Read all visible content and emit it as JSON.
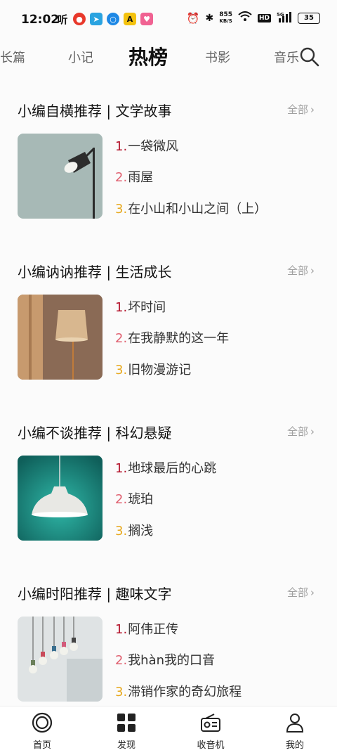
{
  "status_bar": {
    "time": "12:02",
    "speed_value": "855",
    "speed_unit": "KB/S",
    "battery": "35",
    "left_icons": [
      "tingshu-app-icon",
      "weibo-icon",
      "telegram-icon",
      "circle-app-icon",
      "yellow-app-icon",
      "pink-app-icon"
    ],
    "right_icons": [
      "alarm-icon",
      "bluetooth-icon",
      "wifi-icon",
      "hd-icon",
      "signal-5g-icon",
      "battery-icon"
    ]
  },
  "tabs": {
    "items": [
      {
        "label": "长篇",
        "active": false
      },
      {
        "label": "小记",
        "active": false
      },
      {
        "label": "热榜",
        "active": true
      },
      {
        "label": "书影",
        "active": false
      },
      {
        "label": "音乐",
        "active": false
      }
    ],
    "search_icon": "search-icon"
  },
  "sections": [
    {
      "title": "小编自横推荐 | 文学故事",
      "more": "全部",
      "items": [
        {
          "num": "1.",
          "text": "一袋微风"
        },
        {
          "num": "2.",
          "text": "雨屋"
        },
        {
          "num": "3.",
          "text": "在小山和小山之间（上）"
        }
      ]
    },
    {
      "title": "小编讷讷推荐 | 生活成长",
      "more": "全部",
      "items": [
        {
          "num": "1.",
          "text": "坏时间"
        },
        {
          "num": "2.",
          "text": "在我静默的这一年"
        },
        {
          "num": "3.",
          "text": "旧物漫游记"
        }
      ]
    },
    {
      "title": "小编不谈推荐 | 科幻悬疑",
      "more": "全部",
      "items": [
        {
          "num": "1.",
          "text": "地球最后的心跳"
        },
        {
          "num": "2.",
          "text": "琥珀"
        },
        {
          "num": "3.",
          "text": "搁浅"
        }
      ]
    },
    {
      "title": "小编时阳推荐 | 趣味文字",
      "more": "全部",
      "items": [
        {
          "num": "1.",
          "text": "阿伟正传"
        },
        {
          "num": "2.",
          "text": "我hàn我的口音"
        },
        {
          "num": "3.",
          "text": "滞销作家的奇幻旅程"
        }
      ]
    }
  ],
  "colors": {
    "rank1": "#b3132b",
    "rank2": "#e06070",
    "rank3": "#e7a91f",
    "background": "#fbfbfb"
  },
  "bottom_nav": {
    "items": [
      {
        "label": "首页",
        "icon": "home-ring-icon"
      },
      {
        "label": "发现",
        "icon": "grid-icon"
      },
      {
        "label": "收音机",
        "icon": "radio-icon"
      },
      {
        "label": "我的",
        "icon": "person-icon"
      }
    ]
  }
}
